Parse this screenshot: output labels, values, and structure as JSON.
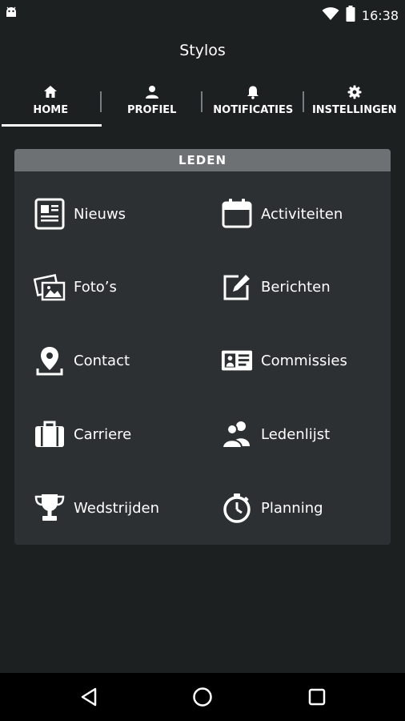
{
  "status": {
    "time": "16:38",
    "icons": [
      "android-icon",
      "wifi-icon",
      "battery-icon"
    ]
  },
  "app": {
    "title": "Stylos"
  },
  "tabs": [
    {
      "label": "HOME",
      "icon": "home-icon",
      "active": true
    },
    {
      "label": "PROFIEL",
      "icon": "person-icon",
      "active": false
    },
    {
      "label": "NOTIFICATIES",
      "icon": "bell-icon",
      "active": false
    },
    {
      "label": "INSTELLINGEN",
      "icon": "gear-icon",
      "active": false
    }
  ],
  "section": {
    "title": "LEDEN",
    "items": [
      {
        "label": "Nieuws",
        "icon": "newspaper-icon"
      },
      {
        "label": "Activiteiten",
        "icon": "calendar-icon"
      },
      {
        "label": "Foto’s",
        "icon": "photos-icon"
      },
      {
        "label": "Berichten",
        "icon": "compose-icon"
      },
      {
        "label": "Contact",
        "icon": "location-pin-icon"
      },
      {
        "label": "Commissies",
        "icon": "id-card-icon"
      },
      {
        "label": "Carriere",
        "icon": "briefcase-icon"
      },
      {
        "label": "Ledenlijst",
        "icon": "people-icon"
      },
      {
        "label": "Wedstrijden",
        "icon": "trophy-icon"
      },
      {
        "label": "Planning",
        "icon": "stopwatch-icon"
      }
    ]
  },
  "navbar": {
    "buttons": [
      "back-icon",
      "home-circle-icon",
      "recents-icon"
    ]
  },
  "colors": {
    "background": "#1d2021",
    "card": "#2c3032",
    "card_header": "#6e7173",
    "text": "#ffffff"
  }
}
